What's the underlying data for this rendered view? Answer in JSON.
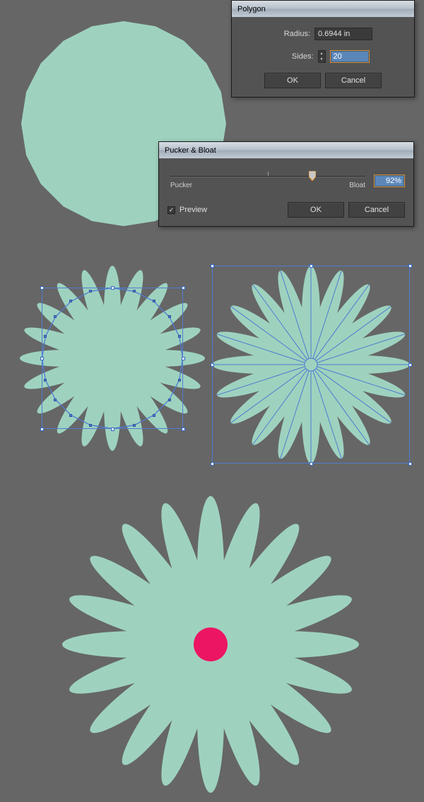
{
  "colors": {
    "petal": "#9ed2bf",
    "center": "#ec1563",
    "selection": "#4f7bd0"
  },
  "polygon_dialog": {
    "title": "Polygon",
    "radius_label": "Radius:",
    "radius_value": "0.6944 in",
    "sides_label": "Sides:",
    "sides_value": "20",
    "ok": "OK",
    "cancel": "Cancel"
  },
  "pucker_bloat_dialog": {
    "title": "Pucker & Bloat",
    "pucker_label": "Pucker",
    "bloat_label": "Bloat",
    "value": "92%",
    "slider_percent": 73,
    "preview_label": "Preview",
    "preview_checked": true,
    "ok": "OK",
    "cancel": "Cancel"
  },
  "shapes": {
    "polygon_sides": 20,
    "petals": 20
  }
}
